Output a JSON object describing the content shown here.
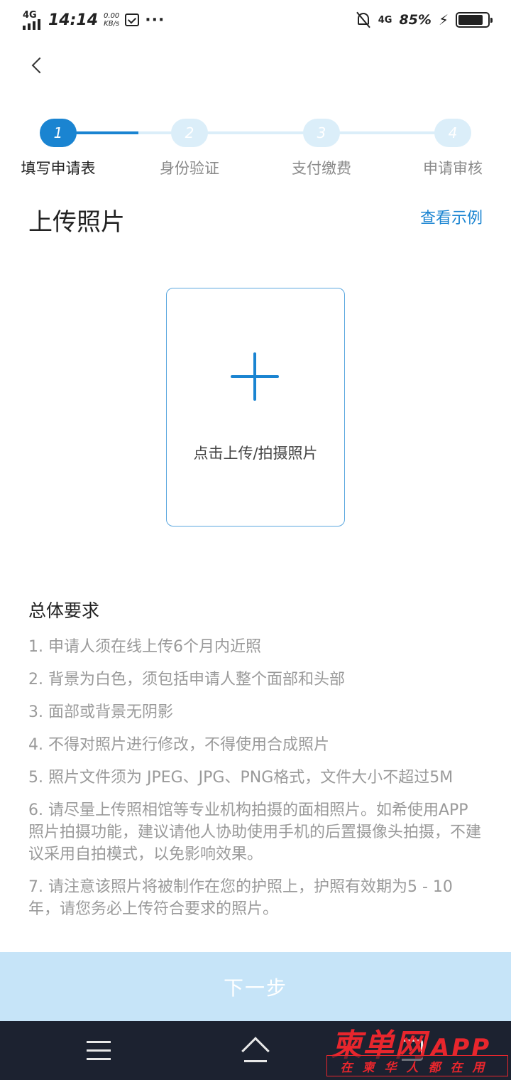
{
  "status_bar": {
    "network": "4G",
    "time": "14:14",
    "speed_value": "0.00",
    "speed_unit": "KB/s",
    "dots": "···",
    "network_right": "4G",
    "battery_percent": "85%",
    "battery_level": 0.85
  },
  "stepper": {
    "steps": [
      {
        "number": "1",
        "label": "填写申请表",
        "active": true
      },
      {
        "number": "2",
        "label": "身份验证",
        "active": false
      },
      {
        "number": "3",
        "label": "支付缴费",
        "active": false
      },
      {
        "number": "4",
        "label": "申请审核",
        "active": false
      }
    ]
  },
  "section": {
    "title": "上传照片",
    "example_link": "查看示例"
  },
  "upload": {
    "label": "点击上传/拍摄照片"
  },
  "requirements": {
    "title": "总体要求",
    "items": [
      "1. 申请人须在线上传6个月内近照",
      "2. 背景为白色，须包括申请人整个面部和头部",
      "3. 面部或背景无阴影",
      "4. 不得对照片进行修改，不得使用合成照片",
      "5. 照片文件须为 JPEG、JPG、PNG格式，文件大小不超过5M",
      "6. 请尽量上传照相馆等专业机构拍摄的面相照片。如希使用APP照片拍摄功能，建议请他人协助使用手机的后置摄像头拍摄，不建议采用自拍模式，以免影响效果。",
      "7. 请注意该照片将被制作在您的护照上，护照有效期为5 - 10年，请您务必上传符合要求的照片。"
    ]
  },
  "next_button": {
    "label": "下一步"
  },
  "watermark": {
    "main": "柬单网",
    "app": "APP",
    "sub": "在柬华人都在用"
  },
  "colors": {
    "accent": "#1a84d1",
    "step_inactive": "#dbeef9",
    "button_disabled": "#c6e4f8",
    "nav_bar": "#1c2230",
    "watermark": "#e8262d"
  }
}
